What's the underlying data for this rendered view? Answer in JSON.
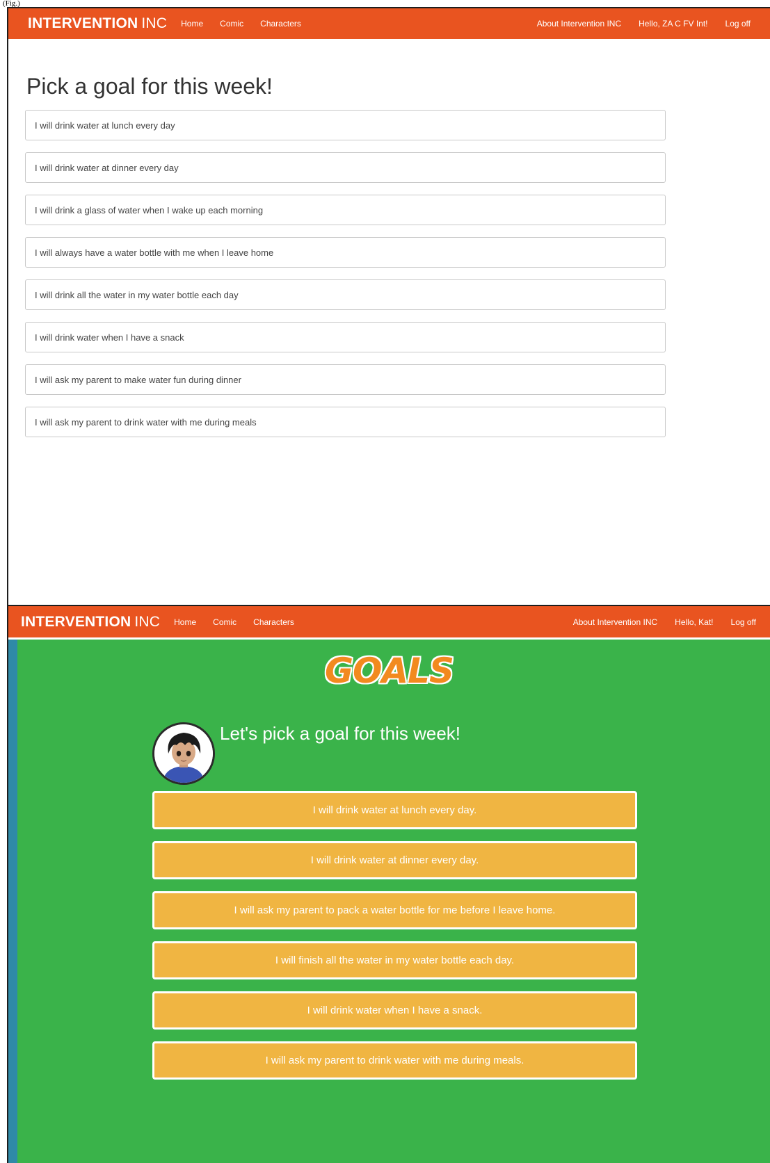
{
  "figure_label": "(Fig.)",
  "top": {
    "navbar": {
      "brand_bold": "INTERVENTION",
      "brand_light": "INC",
      "links": [
        "Home",
        "Comic",
        "Characters"
      ],
      "about": "About Intervention INC",
      "greeting": "Hello, ZA C FV Int!",
      "logoff": "Log off"
    },
    "title": "Pick a goal for this week!",
    "goals": [
      "I will drink water at lunch every day",
      "I will drink water at dinner every day",
      "I will drink a glass of water when I wake up each morning",
      "I will always have a water bottle with me when I leave home",
      "I will drink all the water in my water bottle each day",
      "I will drink water when I have a snack",
      "I will ask my parent to make water fun during dinner",
      "I will ask my parent to drink water with me during meals"
    ]
  },
  "bottom": {
    "navbar": {
      "brand_bold": "INTERVENTION",
      "brand_light": "INC",
      "links": [
        "Home",
        "Comic",
        "Characters"
      ],
      "about": "About Intervention INC",
      "greeting": "Hello, Kat!",
      "logoff": "Log off"
    },
    "goals_heading": "GOALS",
    "subtitle": "Let's pick a goal for this week!",
    "goals": [
      "I will drink water at lunch every day.",
      "I will drink water at dinner every day.",
      "I will ask my parent to pack a water bottle for me before I leave home.",
      "I will finish all the water in my water bottle each day.",
      "I will drink water when I have a snack.",
      "I will ask my parent to drink water with me during meals."
    ]
  },
  "colors": {
    "navbar": "#e95420",
    "green_background": "#3ab34a",
    "goal_button": "#f0b542",
    "goals_heading": "#f28a1f"
  }
}
